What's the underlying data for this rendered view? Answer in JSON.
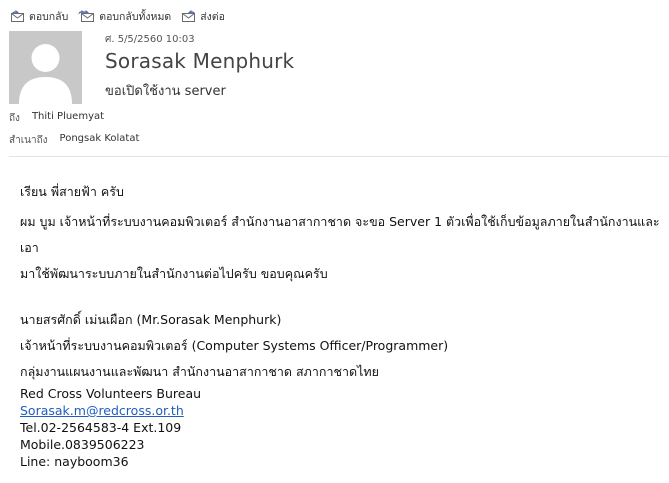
{
  "toolbar": {
    "reply": "ตอบกลับ",
    "reply_all": "ตอบกลับทั้งหมด",
    "forward": "ส่งต่อ"
  },
  "header": {
    "date": "ศ. 5/5/2560 10:03",
    "sender": "Sorasak Menphurk",
    "subject": "ขอเปิดใช้งาน server",
    "to_label": "ถึง",
    "to": "Thiti Pluemyat",
    "cc_label": "สำเนาถึง",
    "cc": "Pongsak Kolatat"
  },
  "body": {
    "greeting": "เรียน พี่สายฟ้า ครับ",
    "line1": "ผม บูม เจ้าหน้าที่ระบบงานคอมพิวเตอร์ สำนักงานอาสากาชาด จะขอ Server 1 ตัวเพื่อใช้เก็บข้อมูลภายในสำนักงานและเอา",
    "line2": "มาใช้พัฒนาระบบภายในสำนักงานต่อไปครับ ขอบคุณครับ"
  },
  "signature": {
    "name": "นายสรศักดิ์ เม่นเผือก (Mr.Sorasak Menphurk)",
    "position": "เจ้าหน้าที่ระบบงานคอมพิวเตอร์ (Computer Systems Officer/Programmer)",
    "department": "กลุ่มงานแผนงานและพัฒนา สำนักงานอาสากาชาด สภากาชาดไทย",
    "org": "Red Cross Volunteers Bureau",
    "email": "Sorasak.m@redcross.or.th",
    "tel": "Tel.02-2564583-4 Ext.109",
    "mobile": "Mobile.0839506223",
    "line": "Line: nayboom36"
  },
  "colors": {
    "link": "#1f5fbf",
    "avatar_bg": "#c8c8c8",
    "icon_accent": "#5b6fb5"
  }
}
